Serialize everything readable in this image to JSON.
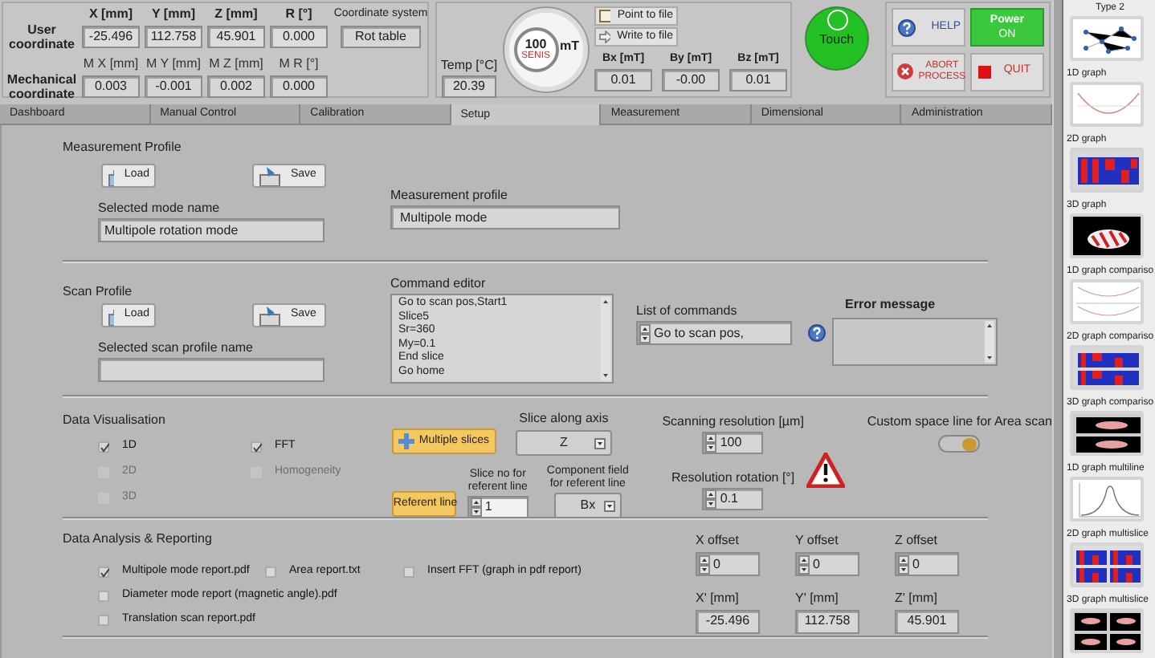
{
  "coordinates": {
    "user_label": "User coordinate",
    "mech_label": "Mechanical coordinate",
    "system_label": "Coordinate system",
    "system": "Rot table",
    "columns": [
      {
        "label": "X [mm]",
        "value": "-25.496",
        "mech_label": "M X [mm]",
        "mech_value": "0.003"
      },
      {
        "label": "Y [mm]",
        "value": "112.758",
        "mech_label": "M Y [mm]",
        "mech_value": "-0.001"
      },
      {
        "label": "Z [mm]",
        "value": "45.901",
        "mech_label": "M Z [mm]",
        "mech_value": "0.002"
      },
      {
        "label": "R [°]",
        "value": "0.000",
        "mech_label": "M R [°]",
        "mech_value": "0.000"
      }
    ]
  },
  "temperature": {
    "label": "Temp [°C]",
    "value": "20.39"
  },
  "gauge": {
    "value": "100",
    "unit": "mT",
    "brand": "SENIS"
  },
  "file_buttons": [
    {
      "kind": "point",
      "label": "Point to file"
    },
    {
      "kind": "write",
      "label": "Write to file"
    }
  ],
  "field": [
    {
      "label": "Bx [mT]",
      "value": "0.01"
    },
    {
      "label": "By [mT]",
      "value": "-0.00"
    },
    {
      "label": "Bz [mT]",
      "value": "0.01"
    }
  ],
  "touch": {
    "label": "Touch",
    "on": true
  },
  "controls": [
    {
      "kind": "help",
      "label": "HELP"
    },
    {
      "kind": "power",
      "label": "Power",
      "state": "ON",
      "on": true
    },
    {
      "kind": "abort",
      "label": "ABORT PROCESS"
    },
    {
      "kind": "quit",
      "label": "QUIT"
    }
  ],
  "tabs": [
    {
      "label": "Dashboard",
      "selected": false
    },
    {
      "label": "Manual Control",
      "selected": false
    },
    {
      "label": "Calibration",
      "selected": false
    },
    {
      "label": "Setup",
      "selected": true
    },
    {
      "label": "Measurement",
      "selected": false
    },
    {
      "label": "Dimensional",
      "selected": false
    },
    {
      "label": "Administration",
      "selected": false
    }
  ],
  "measurement_profile": {
    "title": "Measurement Profile",
    "load": "Load",
    "save": "Save",
    "mode_label": "Selected mode name",
    "mode": "Multipole rotation mode",
    "profile_label": "Measurement profile",
    "profile": "Multipole mode"
  },
  "scan_profile": {
    "title": "Scan Profile",
    "load": "Load",
    "save": "Save",
    "name_label": "Selected scan profile name",
    "editor_label": "Command editor",
    "commands": [
      "Go to scan pos,Start1",
      "Slice5",
      "Sr=360",
      "My=0.1",
      "End slice",
      "Go home"
    ],
    "list_label": "List of commands",
    "list_value": "Go to scan pos,",
    "error_label": "Error message"
  },
  "visualisation": {
    "title": "Data Visualisation",
    "options": [
      {
        "label": "1D",
        "checked": true,
        "disabled": false
      },
      {
        "label": "2D",
        "checked": false,
        "disabled": true
      },
      {
        "label": "3D",
        "checked": false,
        "disabled": true
      },
      {
        "label": "FFT",
        "checked": true,
        "disabled": false
      },
      {
        "label": "Homogeneity",
        "checked": false,
        "disabled": true
      }
    ],
    "multiple_slices": "Multiple slices",
    "referent_line": "Referent line",
    "axis_label": "Slice along axis",
    "axis": "Z",
    "slice_no_label": "Slice no for referent line",
    "slice_no": "1",
    "component_label": "Component field for referent line",
    "component": "Bx",
    "scan_res_label": "Scanning resolution [µm]",
    "scan_res": "100",
    "rot_res_label": "Resolution rotation [°]",
    "rot_res": "0.1",
    "custom_label": "Custom space line for Area scan",
    "custom_on": true
  },
  "reporting": {
    "title": "Data Analysis & Reporting",
    "reports": [
      {
        "label": "Multipole mode report.pdf",
        "checked": true
      },
      {
        "label": "Area report.txt",
        "checked": false
      },
      {
        "label": "Insert FFT (graph in pdf report)",
        "checked": false
      },
      {
        "label": "Diameter mode report (magnetic angle).pdf",
        "checked": false
      },
      {
        "label": "Translation scan report.pdf",
        "checked": false
      }
    ],
    "offsets": [
      {
        "label": "X offset",
        "value": "0"
      },
      {
        "label": "Y offset",
        "value": "0"
      },
      {
        "label": "Z offset",
        "value": "0"
      }
    ],
    "positions": [
      {
        "label": "X' [mm]",
        "value": "-25.496"
      },
      {
        "label": "Y' [mm]",
        "value": "112.758"
      },
      {
        "label": "Z' [mm]",
        "value": "45.901"
      }
    ]
  },
  "sidebar": {
    "items": [
      {
        "label": "Type 2",
        "kind": "network"
      },
      {
        "label": "1D graph",
        "kind": "line"
      },
      {
        "label": "2D graph",
        "kind": "map"
      },
      {
        "label": "3D graph",
        "kind": "surface"
      },
      {
        "label": "1D graph compariso",
        "kind": "line2"
      },
      {
        "label": "2D graph compariso",
        "kind": "map2"
      },
      {
        "label": "3D graph compariso",
        "kind": "surface2"
      },
      {
        "label": "1D graph multiline",
        "kind": "bell"
      },
      {
        "label": "2D graph multislice",
        "kind": "map4"
      },
      {
        "label": "3D graph multislice",
        "kind": "surface4"
      }
    ]
  }
}
